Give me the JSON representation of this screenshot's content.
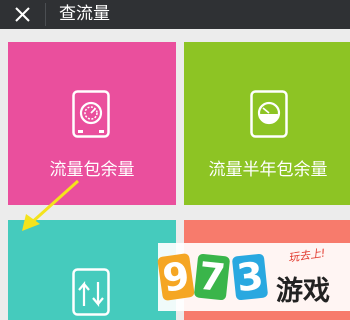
{
  "header": {
    "title": "查流量",
    "close_icon": "close-icon"
  },
  "tiles": [
    {
      "label": "流量包余量",
      "icon": "safe-icon",
      "color": "#ea4f9d"
    },
    {
      "label": "流量半年包余量",
      "icon": "gauge-icon",
      "color": "#8dc424"
    },
    {
      "label": "",
      "icon": "transfer-arrows-icon",
      "color": "#45cbbd"
    },
    {
      "label": "",
      "icon": "",
      "color": "#f77b6c"
    }
  ],
  "watermark": {
    "digits": [
      "9",
      "7",
      "3"
    ],
    "text": "游戏",
    "tagline": "玩去上!"
  },
  "annotation": {
    "icon": "yellow-pointer-arrow"
  }
}
